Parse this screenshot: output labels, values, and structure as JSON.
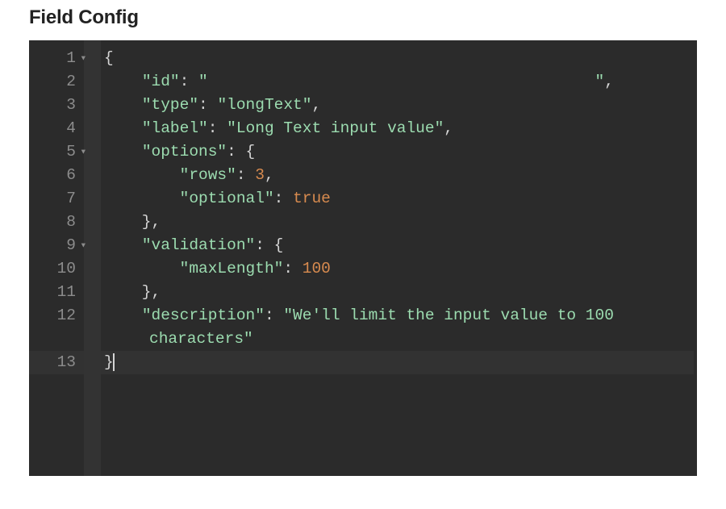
{
  "title": "Field Config",
  "gutter": {
    "lines": [
      "1",
      "2",
      "3",
      "4",
      "5",
      "6",
      "7",
      "8",
      "9",
      "10",
      "11",
      "12",
      "13"
    ],
    "foldable": [
      0,
      4,
      8
    ],
    "active_index": 13
  },
  "code": {
    "tokens": [
      [
        {
          "t": "{",
          "c": "punc"
        }
      ],
      [
        {
          "t": "    ",
          "c": "punc"
        },
        {
          "t": "\"id\"",
          "c": "key"
        },
        {
          "t": ": ",
          "c": "punc"
        },
        {
          "t": "\"                                         \"",
          "c": "str"
        },
        {
          "t": ",",
          "c": "punc"
        }
      ],
      [
        {
          "t": "    ",
          "c": "punc"
        },
        {
          "t": "\"type\"",
          "c": "key"
        },
        {
          "t": ": ",
          "c": "punc"
        },
        {
          "t": "\"longText\"",
          "c": "str"
        },
        {
          "t": ",",
          "c": "punc"
        }
      ],
      [
        {
          "t": "    ",
          "c": "punc"
        },
        {
          "t": "\"label\"",
          "c": "key"
        },
        {
          "t": ": ",
          "c": "punc"
        },
        {
          "t": "\"Long Text input value\"",
          "c": "str"
        },
        {
          "t": ",",
          "c": "punc"
        }
      ],
      [
        {
          "t": "    ",
          "c": "punc"
        },
        {
          "t": "\"options\"",
          "c": "key"
        },
        {
          "t": ": {",
          "c": "punc"
        }
      ],
      [
        {
          "t": "        ",
          "c": "punc"
        },
        {
          "t": "\"rows\"",
          "c": "key"
        },
        {
          "t": ": ",
          "c": "punc"
        },
        {
          "t": "3",
          "c": "num"
        },
        {
          "t": ",",
          "c": "punc"
        }
      ],
      [
        {
          "t": "        ",
          "c": "punc"
        },
        {
          "t": "\"optional\"",
          "c": "key"
        },
        {
          "t": ": ",
          "c": "punc"
        },
        {
          "t": "true",
          "c": "bool"
        }
      ],
      [
        {
          "t": "    },",
          "c": "punc"
        }
      ],
      [
        {
          "t": "    ",
          "c": "punc"
        },
        {
          "t": "\"validation\"",
          "c": "key"
        },
        {
          "t": ": {",
          "c": "punc"
        }
      ],
      [
        {
          "t": "        ",
          "c": "punc"
        },
        {
          "t": "\"maxLength\"",
          "c": "key"
        },
        {
          "t": ": ",
          "c": "punc"
        },
        {
          "t": "100",
          "c": "num"
        }
      ],
      [
        {
          "t": "    },",
          "c": "punc"
        }
      ],
      [
        {
          "t": "    ",
          "c": "punc"
        },
        {
          "t": "\"description\"",
          "c": "key"
        },
        {
          "t": ": ",
          "c": "punc"
        },
        {
          "t": "\"We'll limit the input value to 100 ",
          "c": "str"
        }
      ],
      [
        {
          "t": "characters\"",
          "c": "str",
          "wrapped": true
        }
      ],
      [
        {
          "t": "}",
          "c": "punc",
          "active": true,
          "cursor": true
        }
      ]
    ]
  }
}
